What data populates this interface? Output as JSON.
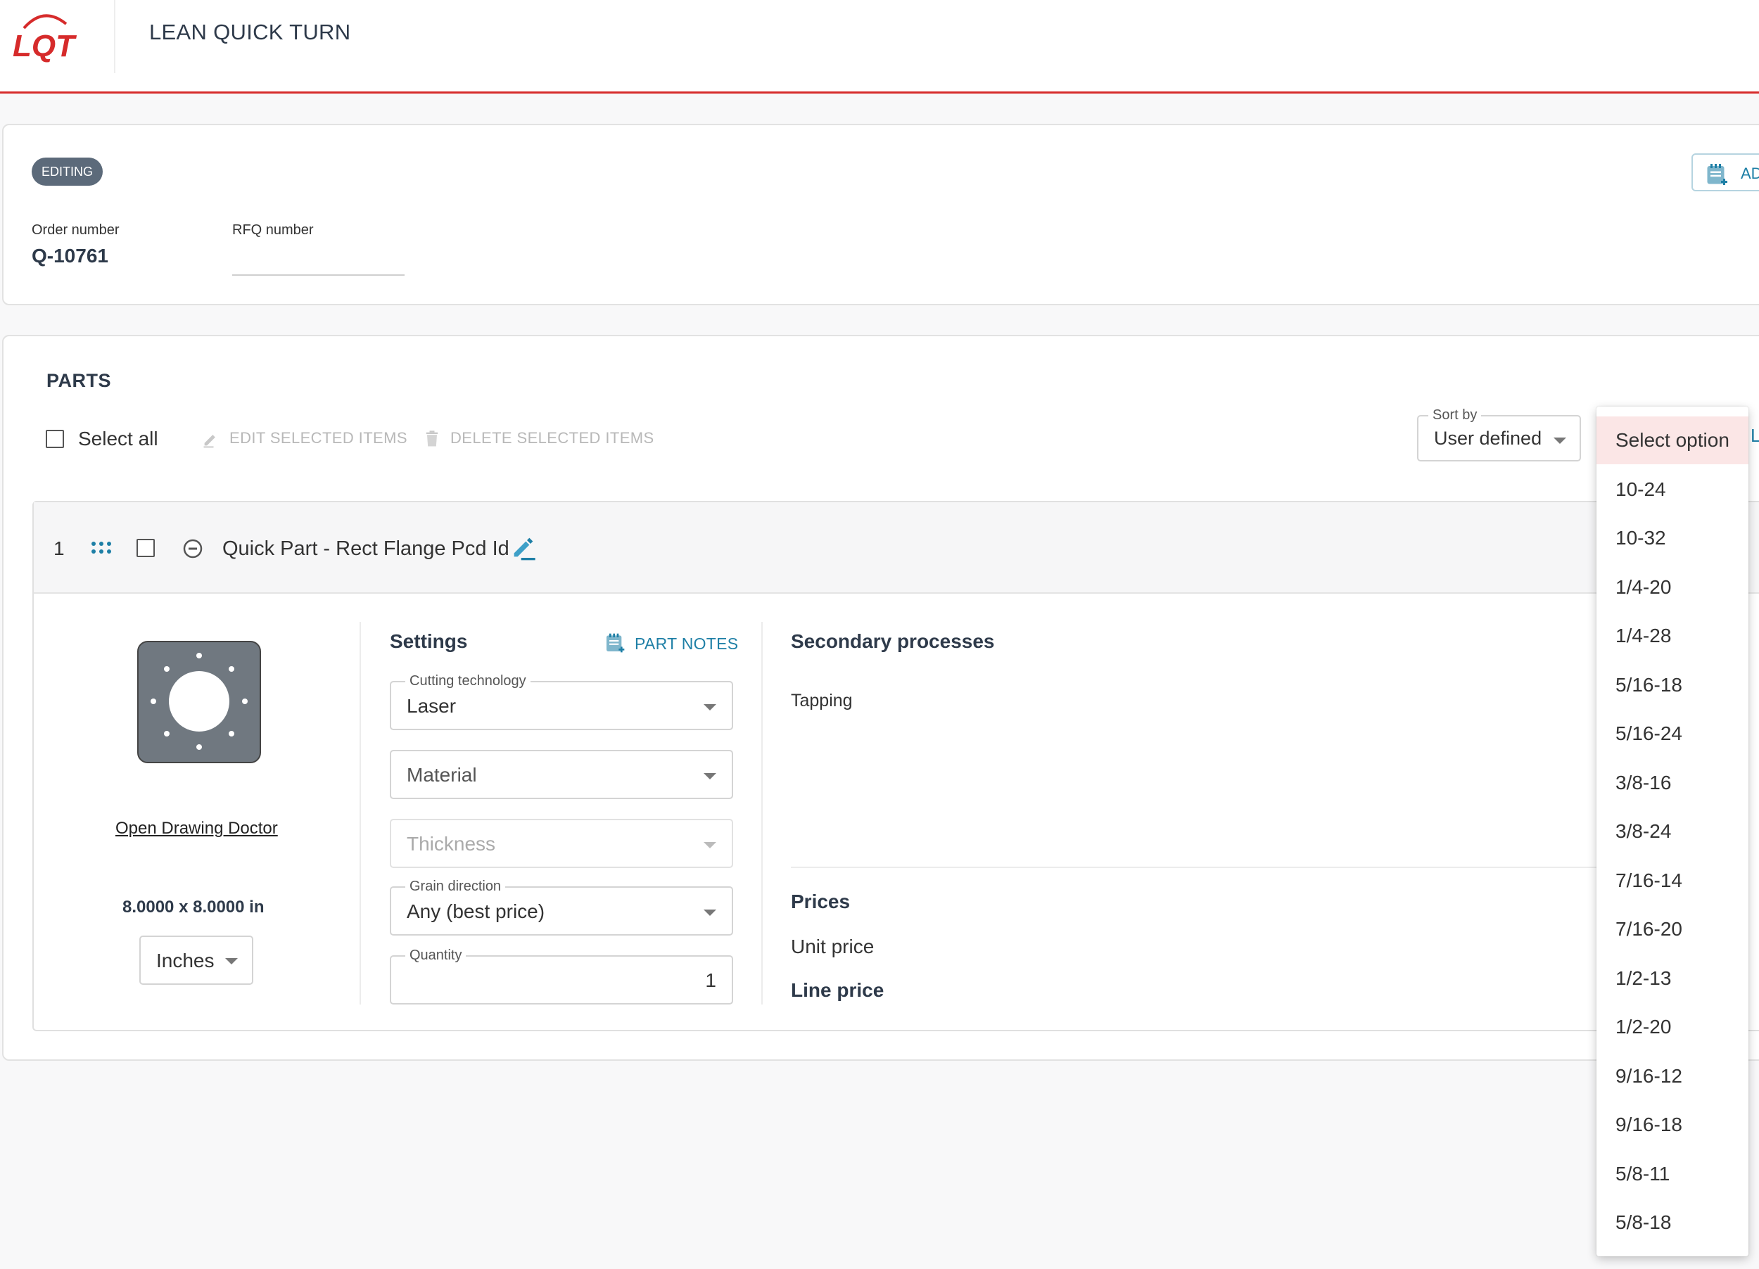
{
  "header": {
    "logo_text": "LQT",
    "app_title": "LEAN QUICK TURN"
  },
  "order": {
    "status_badge": "EDITING",
    "add_button_label": "AD",
    "order_number_label": "Order number",
    "order_number_value": "Q-10761",
    "rfq_number_label": "RFQ number",
    "rfq_number_value": ""
  },
  "parts": {
    "title": "PARTS",
    "select_all_label": "Select all",
    "edit_selected_label": "EDIT SELECTED ITEMS",
    "delete_selected_label": "DELETE SELECTED ITEMS",
    "sort_by_label": "Sort by",
    "sort_by_value": "User defined",
    "peek_label": "L"
  },
  "part": {
    "index": "1",
    "name": "Quick Part - Rect Flange Pcd Id",
    "drawing_link": "Open Drawing Doctor",
    "dimensions": "8.0000 x 8.0000 in",
    "units_value": "Inches",
    "settings": {
      "title": "Settings",
      "notes_label": "PART NOTES",
      "cutting_technology_label": "Cutting technology",
      "cutting_technology_value": "Laser",
      "material_placeholder": "Material",
      "thickness_placeholder": "Thickness",
      "grain_direction_label": "Grain direction",
      "grain_direction_value": "Any (best price)",
      "quantity_label": "Quantity",
      "quantity_value": "1"
    },
    "secondary": {
      "title": "Secondary processes",
      "process": "Tapping"
    },
    "prices": {
      "title": "Prices",
      "unit_price_label": "Unit price",
      "line_price_label": "Line price"
    }
  },
  "dropdown": {
    "options": [
      "Select option",
      "10-24",
      "10-32",
      "1/4-20",
      "1/4-28",
      "5/16-18",
      "5/16-24",
      "3/8-16",
      "3/8-24",
      "7/16-14",
      "7/16-20",
      "1/2-13",
      "1/2-20",
      "9/16-12",
      "9/16-18",
      "5/8-11",
      "5/8-18"
    ],
    "highlighted_index": 0
  },
  "colors": {
    "brand_red": "#d62b2b",
    "accent_blue": "#1e7fa6",
    "badge_gray": "#5c6a7a",
    "highlight": "#fbe6e6"
  }
}
